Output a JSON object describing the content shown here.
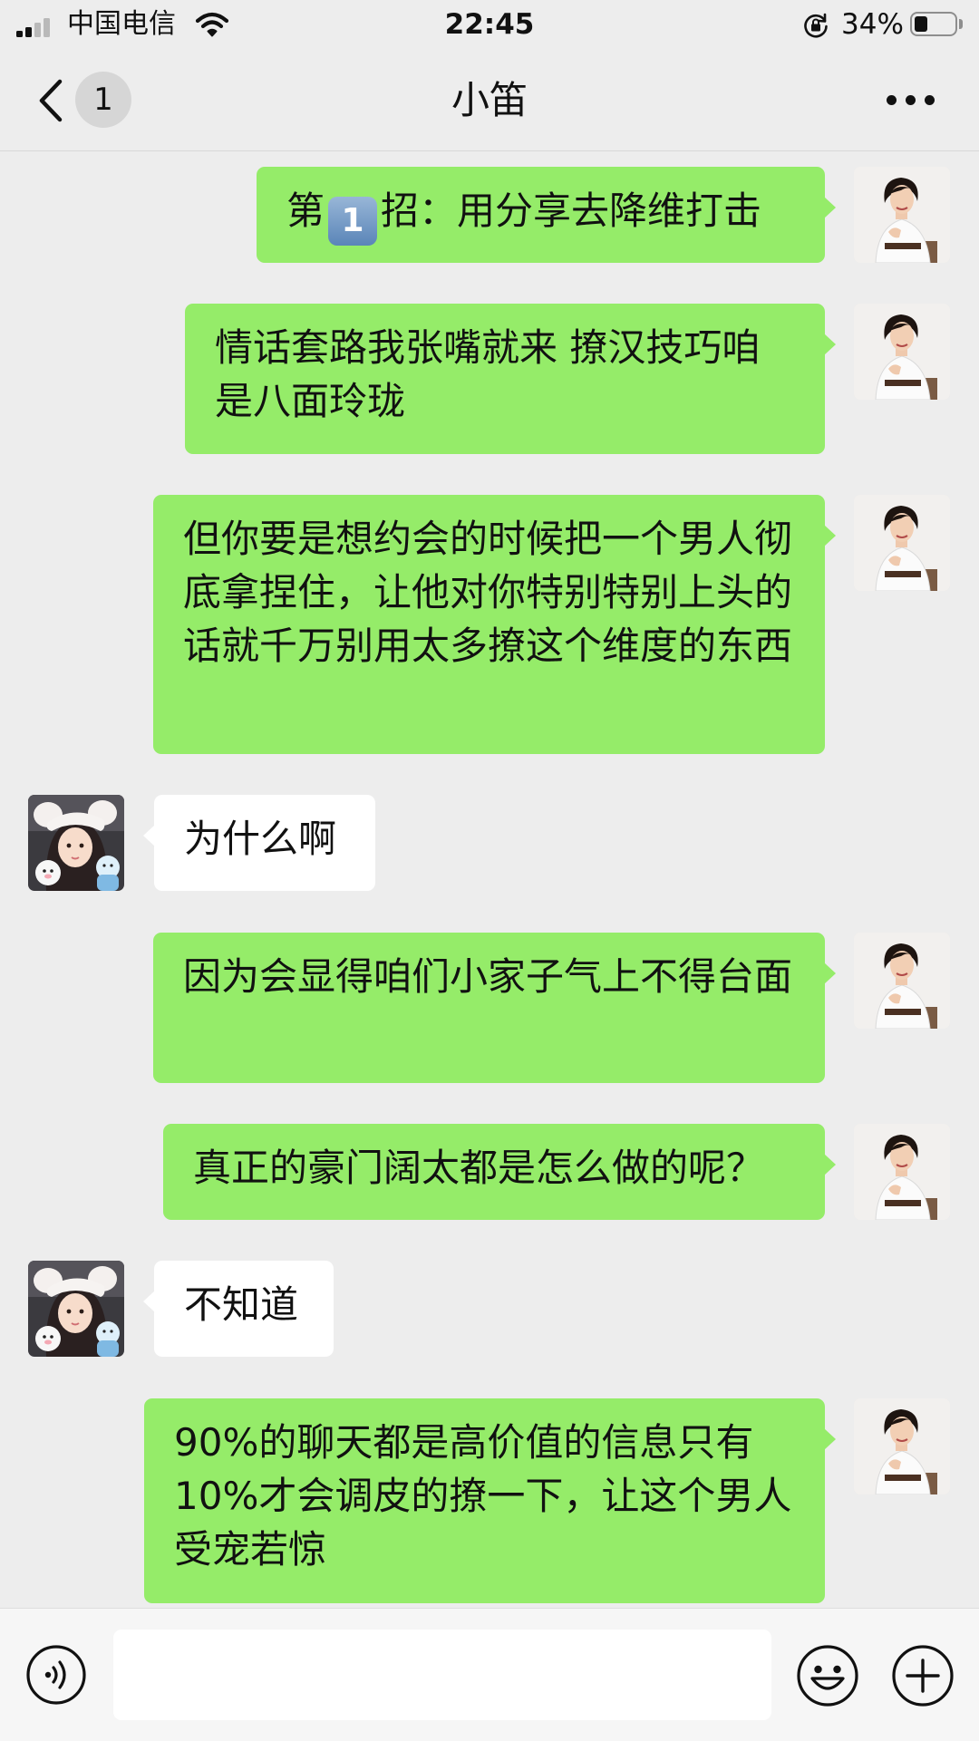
{
  "status_bar": {
    "carrier": "中国电信",
    "time": "22:45",
    "battery_percent": "34%",
    "battery_level": 0.34
  },
  "nav": {
    "back_icon": "chevron-left-icon",
    "unread_count": "1",
    "title": "小笛",
    "more_icon": "more-dots-icon"
  },
  "messages": [
    {
      "side": "out",
      "text_before": "第",
      "badge": "1",
      "text_after": "招：用分享去降维打击"
    },
    {
      "side": "out",
      "text": "情话套路我张嘴就来 撩汉技巧咱是八面玲珑"
    },
    {
      "side": "out",
      "text": "但你要是想约会的时候把一个男人彻底拿捏住，让他对你特别特别上头的话就千万别用太多撩这个维度的东西"
    },
    {
      "side": "in",
      "text": "为什么啊"
    },
    {
      "side": "out",
      "text": "因为会显得咱们小家子气上不得台面"
    },
    {
      "side": "out",
      "text": "真正的豪门阔太都是怎么做的呢？"
    },
    {
      "side": "in",
      "text": "不知道"
    },
    {
      "side": "out",
      "text": "90%的聊天都是高价值的信息只有10%才会调皮的撩一下，让这个男人受宠若惊"
    }
  ],
  "input_bar": {
    "voice_icon": "voice-icon",
    "input_value": "",
    "emoji_icon": "emoji-icon",
    "plus_icon": "plus-circle-icon"
  },
  "colors": {
    "background": "#ededed",
    "outgoing_bubble": "#95ec69",
    "incoming_bubble": "#ffffff"
  }
}
